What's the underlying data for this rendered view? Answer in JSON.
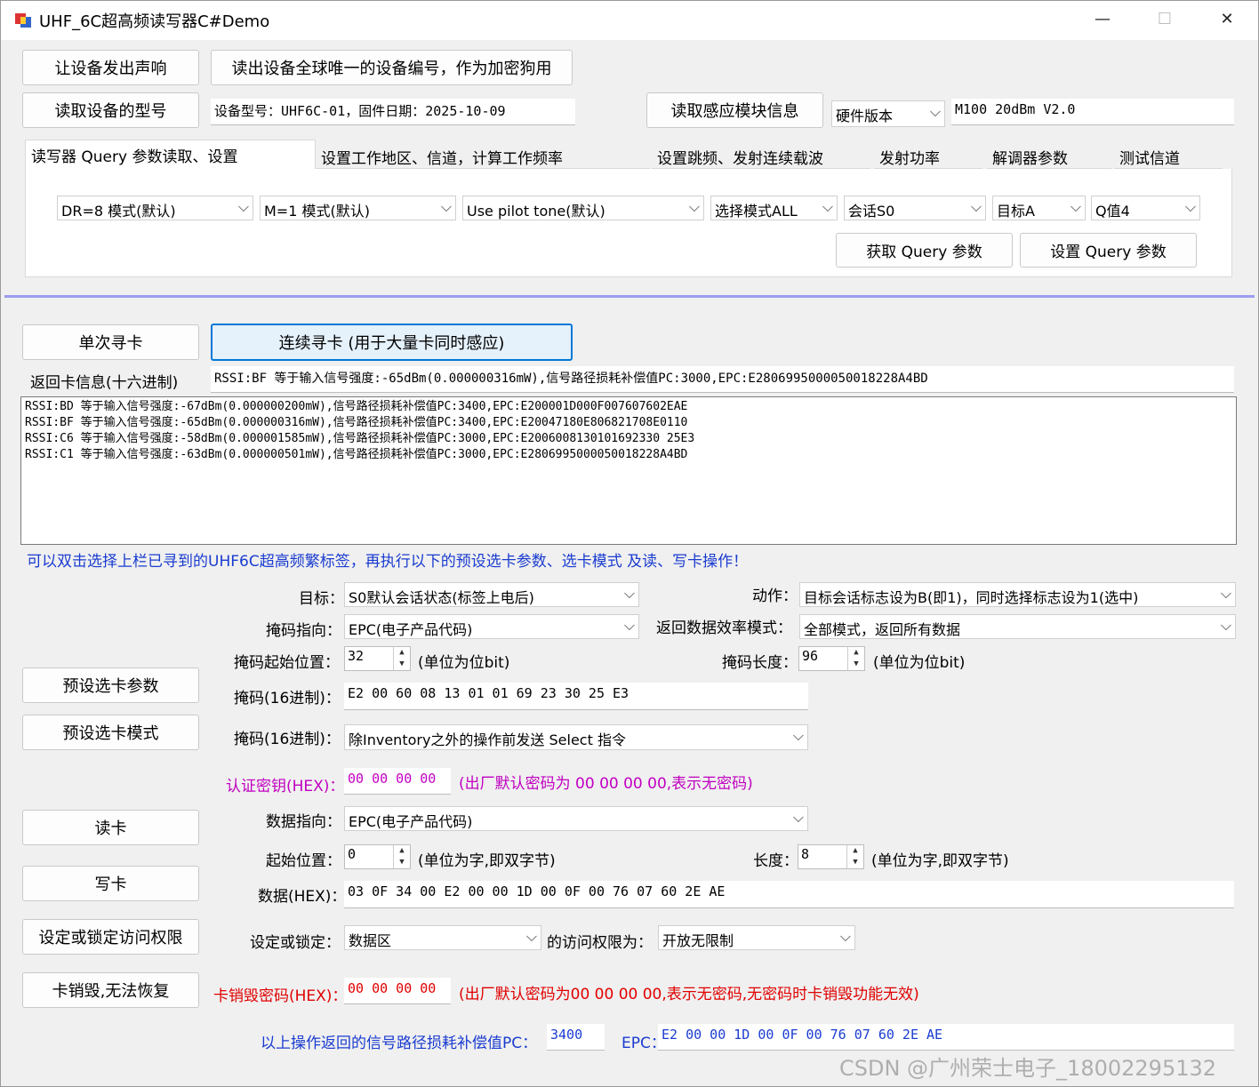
{
  "window": {
    "title": "UHF_6C超高频读写器C#Demo",
    "minimize": "—",
    "maximize": "☐",
    "close": "✕"
  },
  "top": {
    "beep_btn": "让设备发出声响",
    "uid_btn": "读出设备全球唯一的设备编号，作为加密狗用",
    "model_btn": "读取设备的型号",
    "model_value": "设备型号：UHF6C-01，固件日期：2025-10-09",
    "module_btn": "读取感应模块信息",
    "hw_combo": "硬件版本",
    "hw_value": "M100 20dBm V2.0"
  },
  "tabs": [
    "读写器 Query 参数读取、设置",
    "设置工作地区、信道，计算工作频率",
    "设置跳频、发射连续载波",
    "发射功率",
    "解调器参数",
    "测试信道"
  ],
  "query": {
    "dr": "DR=8 模式(默认)",
    "m": "M=1 模式(默认)",
    "pilot": "Use pilot tone(默认)",
    "sel": "选择模式ALL",
    "session": "会话S0",
    "target": "目标A",
    "q": "Q值4",
    "get_btn": "获取 Query 参数",
    "set_btn": "设置 Query 参数"
  },
  "scan": {
    "single_btn": "单次寻卡",
    "continuous_btn": "连续寻卡  (用于大量卡同时感应)",
    "return_label": "返回卡信息(十六进制)",
    "return_value": "RSSI:BF 等于输入信号强度:-65dBm(0.000000316mW),信号路径损耗补偿值PC:3000,EPC:E2806995000050018228A4BD",
    "log": [
      "RSSI:BD 等于输入信号强度:-67dBm(0.000000200mW),信号路径损耗补偿值PC:3400,EPC:E200001D000F007607602EAE",
      "RSSI:BF 等于输入信号强度:-65dBm(0.000000316mW),信号路径损耗补偿值PC:3400,EPC:E20047180E806821708E0110",
      "RSSI:C6 等于输入信号强度:-58dBm(0.000001585mW),信号路径损耗补偿值PC:3000,EPC:E2006008130101692330 25E3",
      "RSSI:C1 等于输入信号强度:-63dBm(0.000000501mW),信号路径损耗补偿值PC:3000,EPC:E2806995000050018228A4BD"
    ],
    "hint": "可以双击选择上栏已寻到的UHF6C超高频繁标签，再执行以下的预设选卡参数、选卡模式 及读、写卡操作！"
  },
  "select": {
    "target_label": "目标：",
    "target_value": "S0默认会话状态(标签上电后)",
    "action_label": "动作：",
    "action_value": "目标会话标志设为B(即1)，同时选择标志设为1(选中)",
    "mask_ptr_label": "掩码指向：",
    "mask_ptr_value": "EPC(电子产品代码)",
    "ret_mode_label": "返回数据效率模式：",
    "ret_mode_value": "全部模式，返回所有数据",
    "mask_start_label": "掩码起始位置：",
    "mask_start_value": "32",
    "unit_bit": "(单位为位bit)",
    "mask_len_label": "掩码长度：",
    "mask_len_value": "96",
    "mask_hex_label": "掩码(16进制)：",
    "mask_hex_value": "E2 00 60 08 13 01 01 69 23 30 25 E3",
    "mask_cmd_label": "掩码(16进制)：",
    "mask_cmd_value": "除Inventory之外的操作前发送 Select 指令",
    "preset_param_btn": "预设选卡参数",
    "preset_mode_btn": "预设选卡模式"
  },
  "rw": {
    "auth_label": "认证密钥(HEX)：",
    "auth_value": "00 00 00 00",
    "auth_note": "(出厂默认密码为 00 00 00 00,表示无密码)",
    "read_btn": "读卡",
    "write_btn": "写卡",
    "lock_btn": "设定或锁定访问权限",
    "kill_btn": "卡销毁,无法恢复",
    "data_ptr_label": "数据指向：",
    "data_ptr_value": "EPC(电子产品代码)",
    "start_label": "起始位置：",
    "start_value": "0",
    "unit_word": "(单位为字,即双字节)",
    "len_label": "长度：",
    "len_value": "8",
    "data_label": "数据(HEX)：",
    "data_value": "03 0F 34 00 E2 00 00 1D 00 0F 00 76 07 60 2E AE",
    "lock_label": "设定或锁定：",
    "lock_area": "数据区",
    "perm_label": "的访问权限为：",
    "perm_value": "开放无限制",
    "kill_label": "卡销毁密码(HEX)：",
    "kill_value": "00 00 00 00",
    "kill_note": "(出厂默认密码为00 00 00 00,表示无密码,无密码时卡销毁功能无效)",
    "pc_label": "以上操作返回的信号路径损耗补偿值PC：",
    "pc_value": "3400",
    "epc_label": "EPC：",
    "epc_value": "E2 00 00 1D 00 0F 00 76 07 60 2E AE"
  },
  "watermark": "CSDN @广州荣士电子_18002295132",
  "colors": {
    "accent": "#0078d7",
    "hint_blue": "#1a3cd0",
    "magenta": "#c000c0",
    "red": "#e00000",
    "divider": "#9c9cf0"
  }
}
